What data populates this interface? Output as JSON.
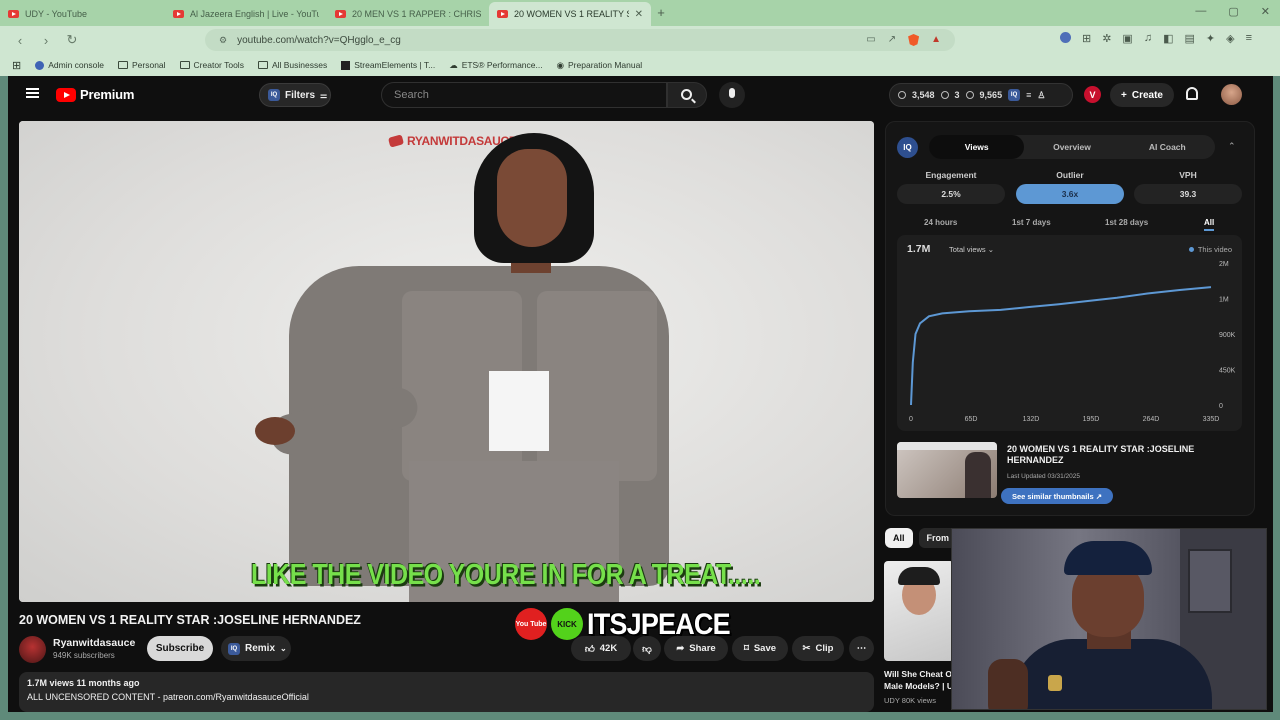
{
  "browser": {
    "tabs": [
      {
        "title": "UDY - YouTube"
      },
      {
        "title": "Al Jazeera English | Live - YouTub"
      },
      {
        "title": "20 MEN VS 1 RAPPER : CHRISEAN R"
      },
      {
        "title": "20 WOMEN VS 1 REALITY STAR :"
      }
    ],
    "url": "youtube.com/watch?v=QHgglo_e_cg",
    "bookmarks": [
      {
        "label": "Admin console"
      },
      {
        "label": "Personal"
      },
      {
        "label": "Creator Tools"
      },
      {
        "label": "All Businesses"
      },
      {
        "label": "StreamElements | T..."
      },
      {
        "label": "ETS® Performance..."
      },
      {
        "label": "Preparation Manual"
      }
    ]
  },
  "header": {
    "logo_text": "Premium",
    "filters_label": "Filters",
    "search_placeholder": "Search",
    "stats": {
      "a": "3,548",
      "b": "3",
      "c": "9,565"
    },
    "avatar_letter": "V",
    "create_label": "Create"
  },
  "video": {
    "watermark": "RYANWITDASAUCE",
    "caption": "LIKE THE VIDEO YOURE IN FOR A TREAT.....",
    "title": "20 WOMEN VS 1 REALITY STAR :JOSELINE HERNANDEZ",
    "channel": "Ryanwitdasauce",
    "subscribers": "949K subscribers",
    "subscribe_label": "Subscribe",
    "remix_label": "Remix",
    "likes": "42K",
    "share_label": "Share",
    "save_label": "Save",
    "clip_label": "Clip",
    "meta": "1.7M views  11 months ago",
    "description": "ALL UNCENSORED CONTENT - patreon.com/RyanwitdasauceOfficial"
  },
  "overlay": {
    "yt_badge": "You Tube",
    "kick_badge": "KICK",
    "streamer": "ITSJPEACE"
  },
  "panel": {
    "logo": "IQ",
    "tabs": [
      {
        "label": "Views"
      },
      {
        "label": "Overview"
      },
      {
        "label": "AI Coach"
      }
    ],
    "metrics": [
      {
        "label": "Engagement",
        "value": "2.5%"
      },
      {
        "label": "Outlier",
        "value": "3.6x"
      },
      {
        "label": "VPH",
        "value": "39.3"
      }
    ],
    "ranges": [
      {
        "label": "24 hours"
      },
      {
        "label": "1st 7 days"
      },
      {
        "label": "1st 28 days"
      },
      {
        "label": "All"
      }
    ],
    "total": "1.7M",
    "dropdown": "Total views",
    "legend": "This video",
    "related_title": "20 WOMEN VS 1 REALITY STAR :JOSELINE HERNANDEZ",
    "related_date": "Last Updated 03/31/2025",
    "similar_label": "See similar thumbnails"
  },
  "chart_data": {
    "type": "line",
    "xlabel": "",
    "ylabel": "",
    "x_ticks": [
      "0",
      "65D",
      "132D",
      "195D",
      "264D",
      "335D"
    ],
    "y_ticks": [
      "2M",
      "1M",
      "900K",
      "450K",
      "0"
    ],
    "series": [
      {
        "name": "This video",
        "x": [
          0,
          2,
          5,
          10,
          20,
          35,
          65,
          100,
          132,
          165,
          195,
          230,
          264,
          300,
          335
        ],
        "y": [
          0,
          600000,
          1000000,
          1150000,
          1250000,
          1290000,
          1320000,
          1340000,
          1380000,
          1420000,
          1460000,
          1510000,
          1570000,
          1620000,
          1660000
        ]
      }
    ]
  },
  "sidebar": {
    "chips": [
      {
        "label": "All"
      },
      {
        "label": "From I"
      }
    ],
    "rec_title": "Will She Cheat O Male Models? | U",
    "rec_meta": "UDY  80K views"
  }
}
